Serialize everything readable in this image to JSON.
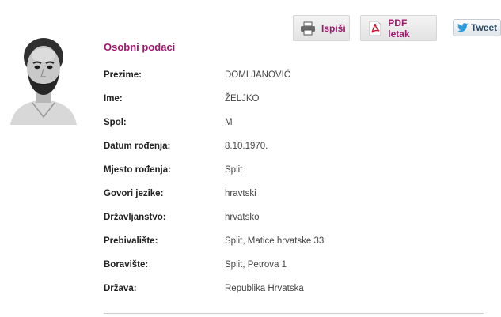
{
  "toolbar": {
    "print_label": "Ispiši",
    "pdf_label": "PDF letak",
    "tweet_label": "Tweet"
  },
  "section": {
    "title": "Osobni podaci"
  },
  "fields": [
    {
      "label": "Prezime:",
      "value": "DOMLJANOVIĆ"
    },
    {
      "label": "Ime:",
      "value": "ŽELJKO"
    },
    {
      "label": "Spol:",
      "value": "M"
    },
    {
      "label": "Datum rođenja:",
      "value": "8.10.1970."
    },
    {
      "label": "Mjesto rođenja:",
      "value": "Split"
    },
    {
      "label": "Govori jezike:",
      "value": "hravtski"
    },
    {
      "label": "Državljanstvo:",
      "value": "hrvatsko"
    },
    {
      "label": "Prebivalište:",
      "value": "Split, Matice hrvatske 33"
    },
    {
      "label": "Boravište:",
      "value": "Split, Petrova 1"
    },
    {
      "label": "Država:",
      "value": "Republika Hrvatska"
    }
  ],
  "icons": {
    "print": "printer-icon",
    "pdf": "pdf-icon",
    "tweet": "twitter-bird-icon"
  },
  "colors": {
    "accent": "#a0176e",
    "twitter_blue": "#2b9be0"
  }
}
